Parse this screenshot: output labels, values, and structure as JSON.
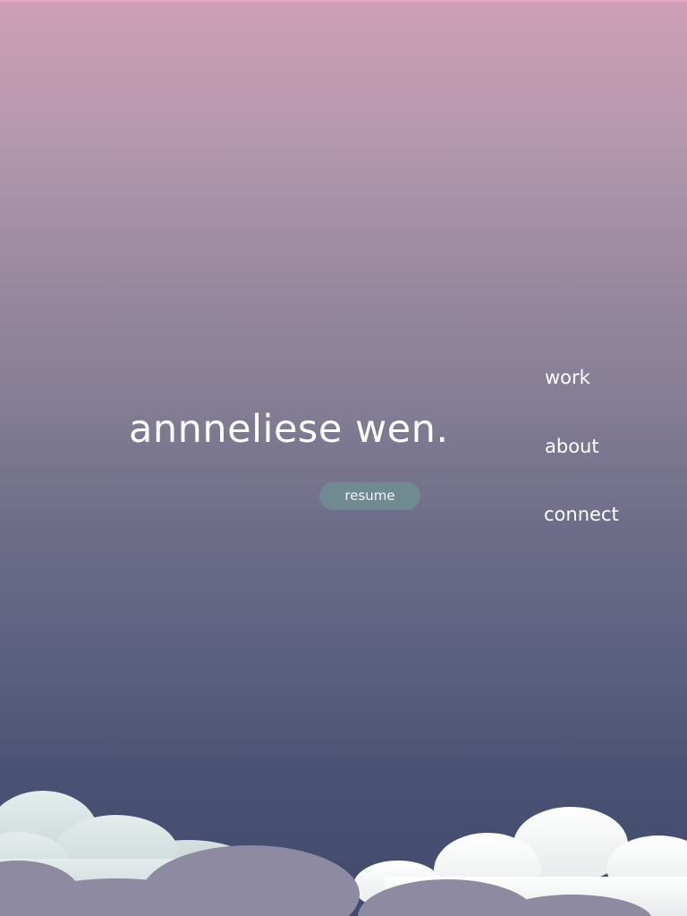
{
  "hero": {
    "name": "annneliese wen.",
    "resume_label": "resume"
  },
  "nav": {
    "items": [
      {
        "label": "work"
      },
      {
        "label": "about"
      },
      {
        "label": "connect"
      }
    ]
  },
  "colors": {
    "gradient_top": "#cda0b4",
    "gradient_bottom": "#404a6c",
    "text": "#ffffff",
    "resume_button": "#6f8a90",
    "cloud_light": "#e8eeee",
    "cloud_dark": "#8e8aa2"
  }
}
